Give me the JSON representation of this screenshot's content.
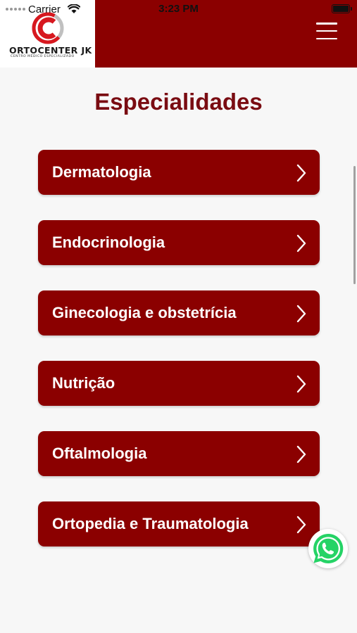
{
  "status_bar": {
    "carrier": "Carrier",
    "time": "3:23 PM",
    "icons": [
      "signal-icon",
      "wifi-icon",
      "battery-icon"
    ]
  },
  "header": {
    "logo": {
      "name": "ORTOCENTER JK",
      "tagline": "CENTRO MÉDICO ESPECIALIZADO"
    },
    "menu_icon": "hamburger-icon"
  },
  "page": {
    "title": "Especialidades"
  },
  "specialties": [
    {
      "label": "Dermatologia"
    },
    {
      "label": "Endocrinologia"
    },
    {
      "label": "Ginecologia e obstetrícia"
    },
    {
      "label": "Nutrição"
    },
    {
      "label": "Oftalmologia"
    },
    {
      "label": "Ortopedia e Traumatologia"
    }
  ],
  "floating": {
    "icon": "whatsapp-icon"
  },
  "colors": {
    "brand": "#8b0000",
    "title": "#7a0c12",
    "background": "#f7f7f7",
    "whatsapp": "#25d366"
  }
}
